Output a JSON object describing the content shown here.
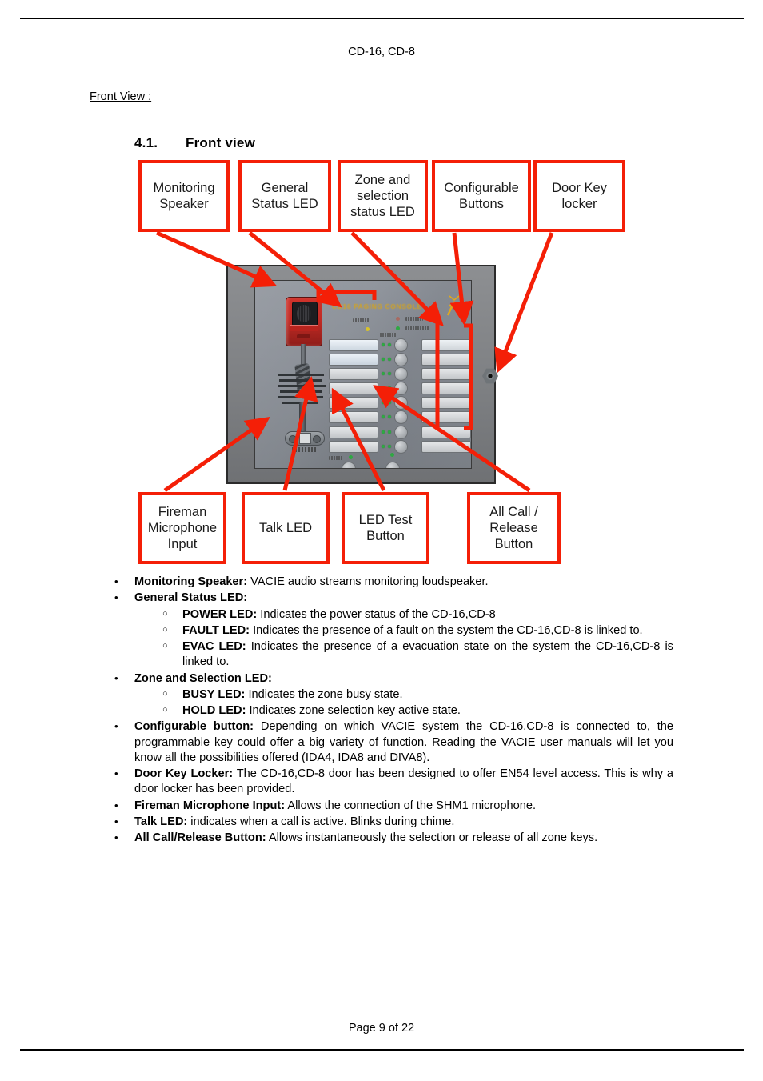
{
  "document": {
    "title": "CD-16, CD-8",
    "front_view_caption": "Front View :",
    "page_footer": "Page 9 of 22"
  },
  "section": {
    "number": "4.1.",
    "title": "Front view"
  },
  "diagram": {
    "device_brand_text": "CD16 PAGING CONSOLE",
    "callouts_top": [
      {
        "id": "monitoring-speaker",
        "label": "Monitoring\nSpeaker"
      },
      {
        "id": "general-status-led",
        "label": "General\nStatus LED"
      },
      {
        "id": "zone-and-selection-status-led",
        "label": "Zone and\nselection\nstatus LED"
      },
      {
        "id": "configurable-buttons",
        "label": "Configurable\nButtons"
      },
      {
        "id": "door-key-locker",
        "label": "Door Key\nlocker"
      }
    ],
    "callouts_bottom": [
      {
        "id": "fireman-microphone-input",
        "label": "Fireman\nMicrophone\nInput"
      },
      {
        "id": "talk-led",
        "label": "Talk LED"
      },
      {
        "id": "led-test-button",
        "label": "LED Test\nButton"
      },
      {
        "id": "all-call-release-button",
        "label": "All Call /\nRelease\nButton"
      }
    ],
    "colors": {
      "callout_border": "#f41f07",
      "leader_line": "#f41f07",
      "device_body": "#7e8083",
      "device_panel": "#878c94",
      "brand_text": "#d8a417",
      "led_green": "#2fa843",
      "mic_red": "#c02a24"
    }
  },
  "features": [
    {
      "term": "Monitoring Speaker:",
      "desc": " VACIE audio streams monitoring loudspeaker.",
      "children": []
    },
    {
      "term": "General Status LED:",
      "desc": "",
      "children": [
        {
          "term": "POWER LED:",
          "desc": " Indicates the power status of the CD-16,CD-8"
        },
        {
          "term": "FAULT LED:",
          "desc": " Indicates the presence of a fault on the system the CD-16,CD-8 is linked to."
        },
        {
          "term": "EVAC LED:",
          "desc": " Indicates the presence of a evacuation state on the system the CD-16,CD-8 is linked to."
        }
      ]
    },
    {
      "term": "Zone and Selection LED:",
      "desc": "",
      "children": [
        {
          "term": "BUSY LED:",
          "desc": " Indicates the zone busy state."
        },
        {
          "term": "HOLD LED:",
          "desc": " Indicates zone selection key active state."
        }
      ]
    },
    {
      "term": "Configurable button:",
      "desc": " Depending on which VACIE system the CD-16,CD-8 is connected to, the programmable key could offer a big variety of function. Reading the VACIE user manuals will let you know all the possibilities offered (IDA4, IDA8 and DIVA8).",
      "children": []
    },
    {
      "term": "Door Key Locker:",
      "desc": " The CD-16,CD-8 door has been designed to offer EN54 level access. This is why a door locker has been provided.",
      "children": []
    },
    {
      "term": "Fireman Microphone Input:",
      "desc": " Allows the connection of the SHM1 microphone.",
      "children": []
    },
    {
      "term": "Talk LED:",
      "desc": " indicates when a call is active. Blinks during chime.",
      "children": []
    },
    {
      "term": "All Call/Release Button:",
      "desc": " Allows instantaneously the selection or release of all zone keys.",
      "children": []
    }
  ]
}
